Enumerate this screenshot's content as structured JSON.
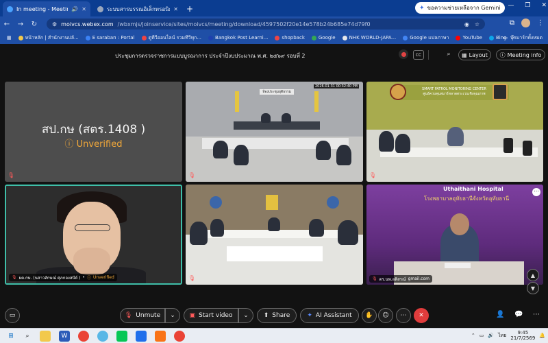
{
  "browser": {
    "tabs": [
      {
        "title": "In meeting - Meeting · Webex",
        "active": true
      },
      {
        "title": "ระบบสารบรรณอิเล็กทรอนิกส์",
        "active": false
      }
    ],
    "gemini_label": "ขอความช่วยเหลือจาก Gemini",
    "url_host": "moivcs.webex.com",
    "url_path": "/wbxmjs/joinservice/sites/moivcs/meeting/download/4597502f20e14e578b24b685e74d79f0",
    "bookmarks": [
      {
        "label": "หน้าหลัก | สำนักงานปลั...",
        "color": "#f2c94c"
      },
      {
        "label": "E saraban : Portal",
        "color": "#3b82f6"
      },
      {
        "label": "ดูทีวีออนไลน์ รวมทีวีทุก...",
        "color": "#ef4444"
      },
      {
        "label": "Bangkok Post Learni...",
        "color": "#1e40af"
      },
      {
        "label": "shopback",
        "color": "#ef4444"
      },
      {
        "label": "Google",
        "color": "#34a853"
      },
      {
        "label": "NHK WORLD-JAPA...",
        "color": "#e5e7eb"
      },
      {
        "label": "Google แปลภาษา",
        "color": "#4285f4"
      },
      {
        "label": "YouTube",
        "color": "#ff0000"
      },
      {
        "label": "Bing",
        "color": "#0ea5e9"
      }
    ],
    "bookmarks_more": "»",
    "bookmarks_folder": "บุ๊กมาร์กทั้งหมด"
  },
  "meeting": {
    "title": "ประชุมการตรวจราชการแบบบูรณาการ ประจำปีงบประมาณ พ.ศ. ๒๕๖๙ รอบที่ 2",
    "cc_label": "CC",
    "layout_label": "Layout",
    "info_label": "Meeting info",
    "tiles": {
      "t1_name": "สป.กษ (สตร.1408 )",
      "t1_unverified": "Unverified",
      "t2_sign": "ห้องประชุมยุติธรรม",
      "t2_timestamp": "2026-01-31 00:32:40 PM",
      "t3_banner": "SMART PATROL MONITORING CENTER",
      "t3_banner_th": "ศูนย์ควบคุมสมาร์ทลาดตระเวนเชิงคุณภาพ",
      "t4_label": "ผต.กษ. (นสาวลักษณ์ ศุภกองสนีย์ )",
      "t4_unverified": "Unverified",
      "t6_hospital": "Uthaithani Hospital",
      "t6_hospital_th": "โรงพยาบาลอุทัยธานีจังหวัดอุทัยธานี",
      "t6_label": "ดร.นพ.อติสรณ์",
      "t6_email": "gmail.com"
    }
  },
  "controls": {
    "unmute": "Unmute",
    "start_video": "Start video",
    "share": "Share",
    "ai_assistant": "AI Assistant"
  },
  "taskbar": {
    "lang": "ไทย",
    "time": "9:45",
    "date": "21/7/2569"
  }
}
